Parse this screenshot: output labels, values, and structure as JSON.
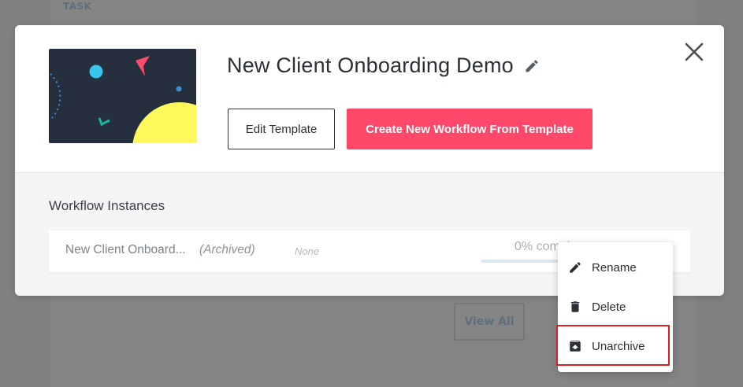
{
  "background": {
    "top_text": "TASK",
    "view_all_label": "View All"
  },
  "modal": {
    "title": "New Client Onboarding Demo",
    "edit_template_label": "Edit Template",
    "create_workflow_label": "Create New Workflow From Template",
    "section_title": "Workflow Instances",
    "instance": {
      "name": "New Client Onboard...",
      "status": "(Archived)",
      "assignee": "None",
      "progress_text": "0% complete",
      "progress": 0
    }
  },
  "menu": {
    "items": [
      {
        "label": "Rename",
        "icon": "pencil-icon"
      },
      {
        "label": "Delete",
        "icon": "trash-icon"
      },
      {
        "label": "Unarchive",
        "icon": "unarchive-icon"
      }
    ]
  },
  "colors": {
    "primary": "#fe4869",
    "thumb_bg": "#262f3d",
    "thumb_yellow": "#fdf95b",
    "thumb_cyan": "#37c5ee",
    "thumb_teal": "#18b5a0",
    "highlight": "#e02020"
  }
}
